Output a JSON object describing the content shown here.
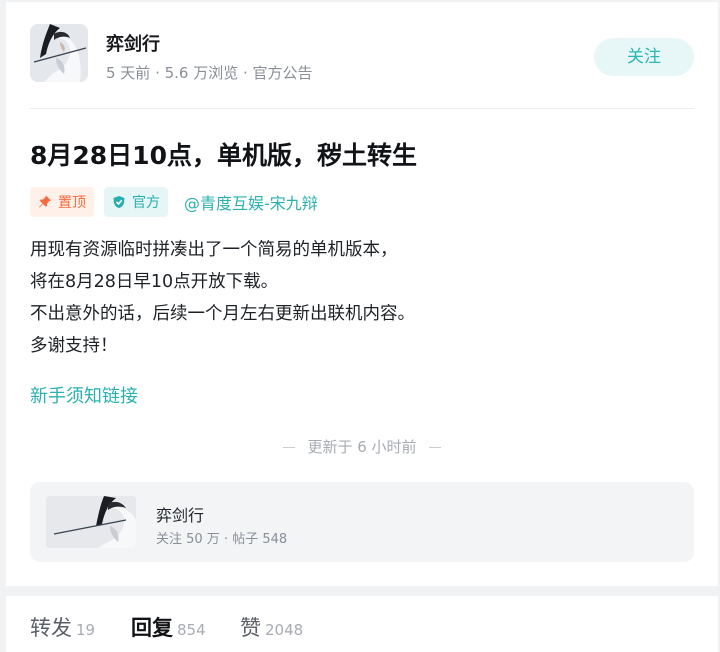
{
  "author": {
    "name": "弈剑行",
    "meta": "5 天前 · 5.6 万浏览 · 官方公告",
    "follow_label": "关注"
  },
  "post": {
    "title": "8月28日10点，单机版，秽土转生",
    "tags": {
      "pinned": "置顶",
      "official": "官方"
    },
    "mention": "@青度互娱-宋九辩",
    "lines": [
      "用现有资源临时拼凑出了一个简易的单机版本，",
      "将在8月28日早10点开放下载。",
      "不出意外的话，后续一个月左右更新出联机内容。",
      "多谢支持！"
    ],
    "link_text": "新手须知链接",
    "updated_text": "更新于 6 小时前"
  },
  "forum": {
    "name": "弈剑行",
    "stats": "关注 50 万 · 帖子 548"
  },
  "actions": [
    {
      "label": "转发",
      "count": "19"
    },
    {
      "label": "回复",
      "count": "854"
    },
    {
      "label": "赞",
      "count": "2048"
    }
  ],
  "colors": {
    "accent": "#2bb0b0",
    "pinned": "#f56a3d",
    "follow_bg": "#e7f7f7"
  },
  "icons": {
    "pinned": "pin-icon",
    "official": "shield-check-icon"
  }
}
